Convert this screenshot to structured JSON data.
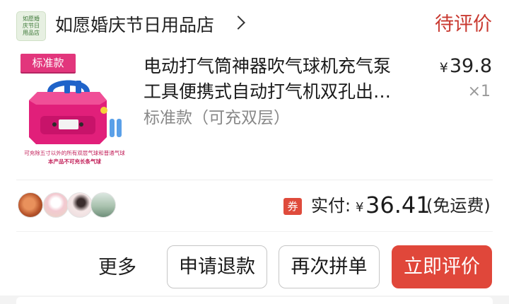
{
  "shop": {
    "logo_text": "如愿婚\n庆节日\n用品店",
    "name": "如愿婚庆节日用品店",
    "arrow_icon": "chevron-right-icon"
  },
  "order": {
    "status": "待评价"
  },
  "product": {
    "image_tag": "标准款",
    "image_caption_1": "可充除五寸以外的所有双层气球和普通气球",
    "image_caption_2": "本产品不可充长条气球",
    "image_colors": {
      "body": "#e11f7a",
      "handle": "#1f63c9",
      "nozzle": "#5aa0e8"
    },
    "title_line_1": "电动打气筒神器吹气球机充气泵",
    "title_line_2": "工具便携式自动打气机双孔出…",
    "variant": "标准款（可充双层）",
    "price_currency": "¥",
    "price": "39.8",
    "quantity": "×1"
  },
  "summary": {
    "avatars": [
      {
        "name": "avatar-rose",
        "color": "#c96a3a"
      },
      {
        "name": "avatar-cartoon",
        "color": "#efd6c8"
      },
      {
        "name": "avatar-girl",
        "color": "#f2e2e2"
      },
      {
        "name": "avatar-landscape",
        "color": "#9fb8a6"
      }
    ],
    "coupon_label": "券",
    "paid_label": "实付:",
    "paid_currency": "¥",
    "paid_amount": "36.41",
    "paid_note": "(免运费)"
  },
  "actions": {
    "more": "更多",
    "refund": "申请退款",
    "reorder": "再次拼单",
    "review": "立即评价"
  },
  "colors": {
    "accent": "#e0473a",
    "status": "#c93a31"
  }
}
